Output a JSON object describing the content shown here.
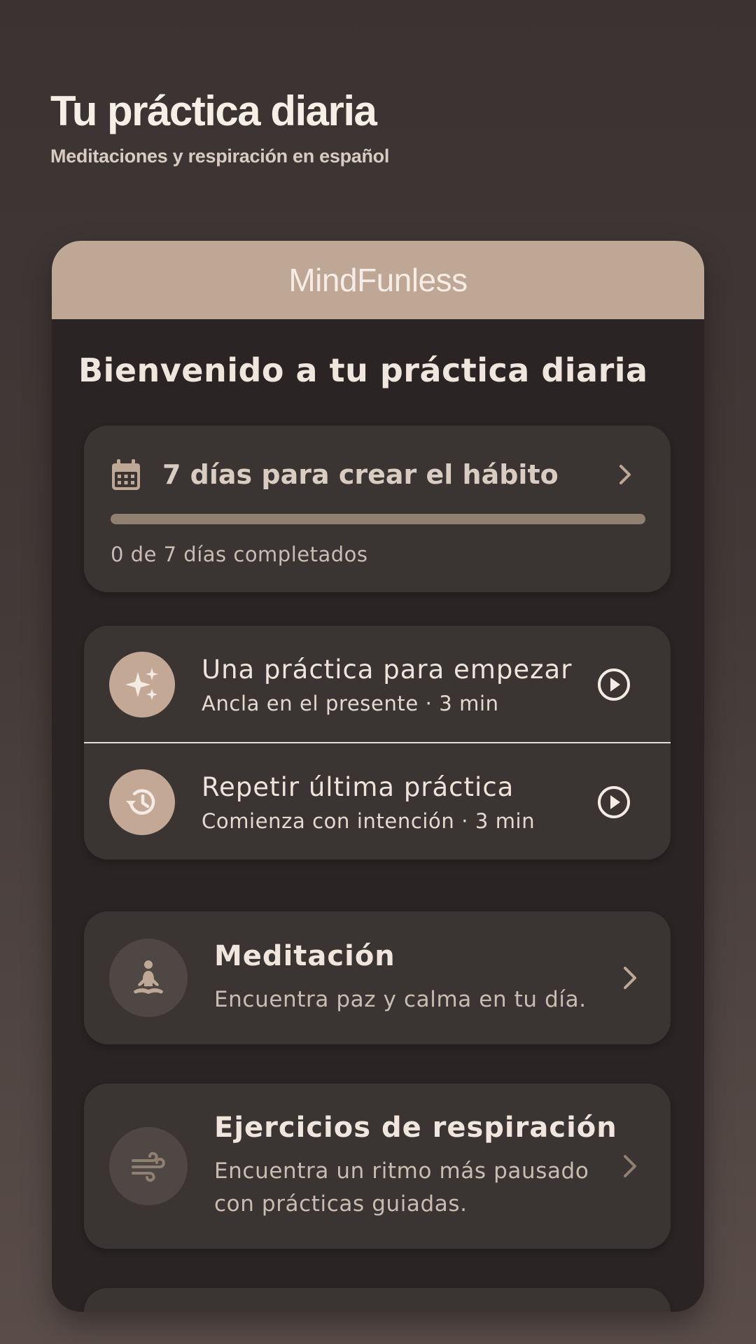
{
  "header": {
    "title": "Tu práctica diaria",
    "subtitle": "Meditaciones y respiración en español"
  },
  "app": {
    "name": "MindFunless",
    "welcome": "Bienvenido a tu práctica diaria"
  },
  "habit": {
    "icon": "calendar-icon",
    "title": "7 días para crear el hábito",
    "progress_text": "0 de 7 días completados",
    "completed": 0,
    "total": 7
  },
  "practices": [
    {
      "icon": "sparkles-icon",
      "title": "Una práctica para empezar",
      "subtitle": "Ancla en el presente · 3 min"
    },
    {
      "icon": "history-icon",
      "title": "Repetir última práctica",
      "subtitle": "Comienza con intención · 3 min"
    }
  ],
  "features": [
    {
      "icon": "meditation-icon",
      "title": "Meditación",
      "description": "Encuentra paz y calma en tu día."
    },
    {
      "icon": "wind-icon",
      "title": "Ejercicios de respiración",
      "description": "Encuentra un ritmo más pausado con prácticas guiadas."
    }
  ],
  "colors": {
    "accent": "#bea895",
    "background": "#2a2524",
    "card": "#3a3533"
  }
}
